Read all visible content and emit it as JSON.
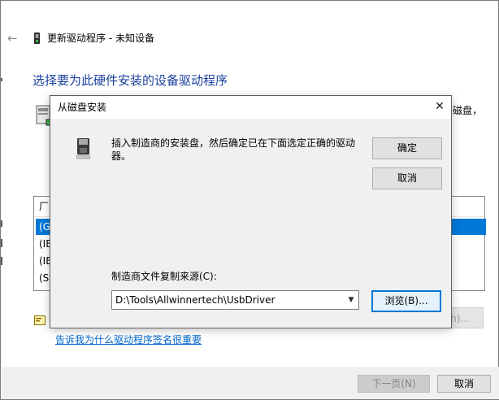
{
  "wizard": {
    "title": "更新驱动程序 - 未知设备",
    "heading": "选择要为此硬件安装的设备驱动程序",
    "intro_peek": "磁盘，",
    "list_header": "厂",
    "list_items": [
      "(G",
      "(IE",
      "(IE",
      "(St"
    ],
    "have_disk_label": "h)...",
    "signature_link": "告诉我为什么驱动程序签名很重要",
    "next_label": "下一页(N)",
    "cancel_label": "取消"
  },
  "dialog": {
    "title": "从磁盘安装",
    "close_glyph": "✕",
    "instruction": "插入制造商的安装盘，然后确定已在下面选定正确的驱动器。",
    "ok_label": "确定",
    "cancel_label": "取消",
    "source_label": "制造商文件复制来源(C):",
    "source_value": "D:\\Tools\\Allwinnertech\\UsbDriver",
    "browse_label": "浏览(B)..."
  },
  "icons": {
    "back": "back-arrow-icon",
    "device": "device-icon",
    "hardware": "hardware-icon",
    "disk": "floppy-disk-icon",
    "signature": "signature-icon"
  },
  "colors": {
    "heading": "#1a3f9c",
    "link": "#0066cc",
    "selection": "#0078d7",
    "focus_border": "#0078d7"
  }
}
